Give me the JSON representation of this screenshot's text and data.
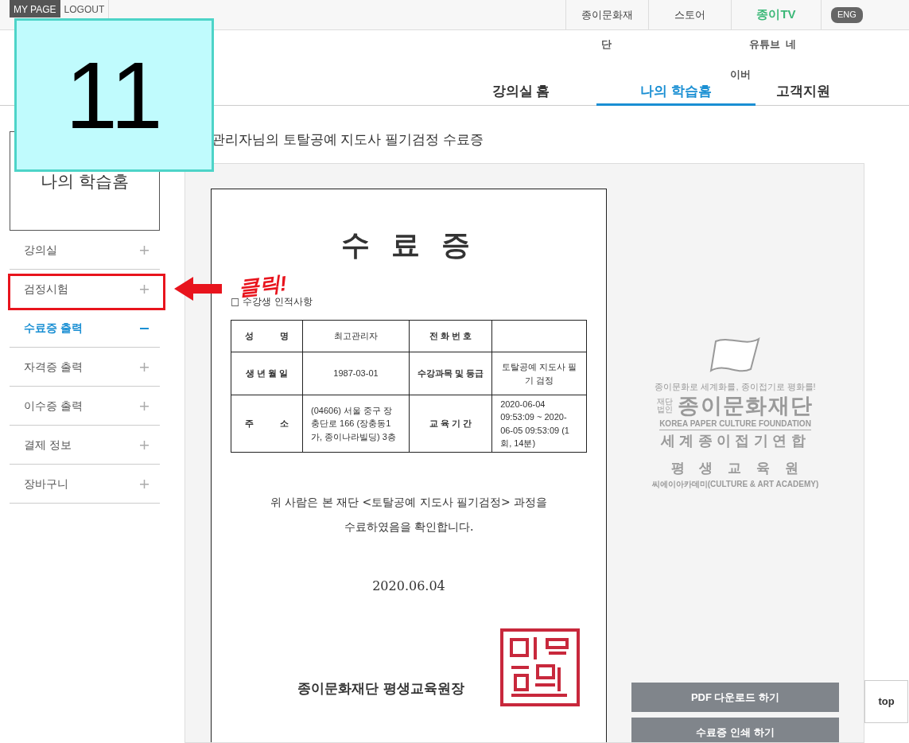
{
  "top_bar": {
    "links": [
      {
        "label": "MY PAGE",
        "selected": true
      },
      {
        "label": "LOGOUT",
        "selected": false
      }
    ],
    "right_links": [
      "종이문화재",
      "스토어"
    ],
    "tv_logo": "종이TV",
    "lang": "ENG"
  },
  "nav": {
    "items": [
      {
        "label": "강의실 홈",
        "selected": false
      },
      {
        "label": "나의 학습홈",
        "selected": true
      },
      {
        "label": "고객지원",
        "selected": false
      }
    ],
    "stray_texts": [
      "단",
      "유튜브  네",
      "이버"
    ]
  },
  "sidebar": {
    "title": "나의 학습홈",
    "items": [
      {
        "label": "강의실",
        "expanded": false,
        "annotated": false
      },
      {
        "label": "검정시험",
        "expanded": false,
        "annotated": true
      },
      {
        "label": "수료증 출력",
        "expanded": true,
        "annotated": false
      },
      {
        "label": "자격증 출력",
        "expanded": false,
        "annotated": false
      },
      {
        "label": "이수증 출력",
        "expanded": false,
        "annotated": false
      },
      {
        "label": "결제 정보",
        "expanded": false,
        "annotated": false
      },
      {
        "label": "장바구니",
        "expanded": false,
        "annotated": false
      }
    ]
  },
  "page_title": "관리자님의 토탈공예 지도사 필기검정 수료증",
  "certificate": {
    "title": "수 료 증",
    "section": "□ 수강생 인적사항",
    "rows": [
      [
        "성　　　명",
        "최고관리자",
        "전 화 번 호",
        ""
      ],
      [
        "생 년 월 일",
        "1987-03-01",
        "수강과목 및 등급",
        "토탈공예 지도사 필기 검정"
      ],
      [
        "주　　　소",
        "(04606) 서울 중구 장충단로 166 (장충동1가, 종이나라빌딩) 3층",
        "교 육 기 간",
        "2020-06-04 09:53:09 ~ 2020-06-05 09:53:09 (1회, 14분)"
      ]
    ],
    "statement": [
      "위 사람은 본 재단 <토탈공예 지도사 필기검정> 과정을",
      "수료하였음을 확인합니다."
    ],
    "date": "2020.06.04",
    "issuer": "종이문화재단 평생교육원장"
  },
  "watermark_logo": {
    "slogan": "종이문화로 세계화를, 종이접기로 평화를!",
    "badge": "재단법인",
    "name": "종이문화재단",
    "english": "KOREA PAPER CULTURE FOUNDATION",
    "line2": "세계종이접기연합",
    "line3": "평생교육원",
    "line4": "씨에이아카데미(CULTURE & ART ACADEMY)"
  },
  "buttons": [
    "PDF 다운로드 하기",
    "수료증 인쇄 하기"
  ],
  "top_button": "top",
  "annotation": {
    "step": "11",
    "note": "클릭!"
  }
}
